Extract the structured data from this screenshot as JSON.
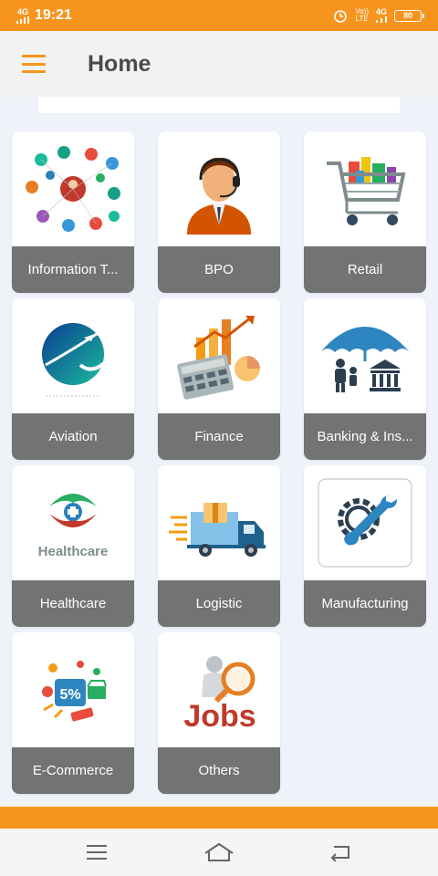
{
  "status_bar": {
    "network_left": "4G",
    "time": "19:21",
    "volte_label": "Vo))\nLTE",
    "network_right": "4G",
    "battery": "80"
  },
  "app_bar": {
    "title": "Home"
  },
  "categories": [
    {
      "label": "Information T...",
      "icon": "people-network-icon"
    },
    {
      "label": "BPO",
      "icon": "call-center-agent-icon"
    },
    {
      "label": "Retail",
      "icon": "shopping-cart-icon"
    },
    {
      "label": "Aviation",
      "icon": "airplane-globe-icon"
    },
    {
      "label": "Finance",
      "icon": "calculator-chart-icon"
    },
    {
      "label": "Banking & Ins...",
      "icon": "umbrella-bank-icon"
    },
    {
      "label": "Healthcare",
      "icon": "healthcare-logo-icon",
      "logo_text": "Healthcare"
    },
    {
      "label": "Logistic",
      "icon": "delivery-truck-icon"
    },
    {
      "label": "Manufacturing",
      "icon": "gear-wrench-icon"
    },
    {
      "label": "E-Commerce",
      "icon": "ecommerce-sale-icon",
      "badge_text": "5%"
    },
    {
      "label": "Others",
      "icon": "jobs-magnifier-icon",
      "logo_text": "Jobs"
    }
  ],
  "colors": {
    "accent": "#f7941d",
    "label_bg": "#737373",
    "page_bg": "#eef2f9"
  },
  "nav": {
    "buttons": [
      "menu-nav-icon",
      "home-nav-icon",
      "back-nav-icon"
    ]
  }
}
